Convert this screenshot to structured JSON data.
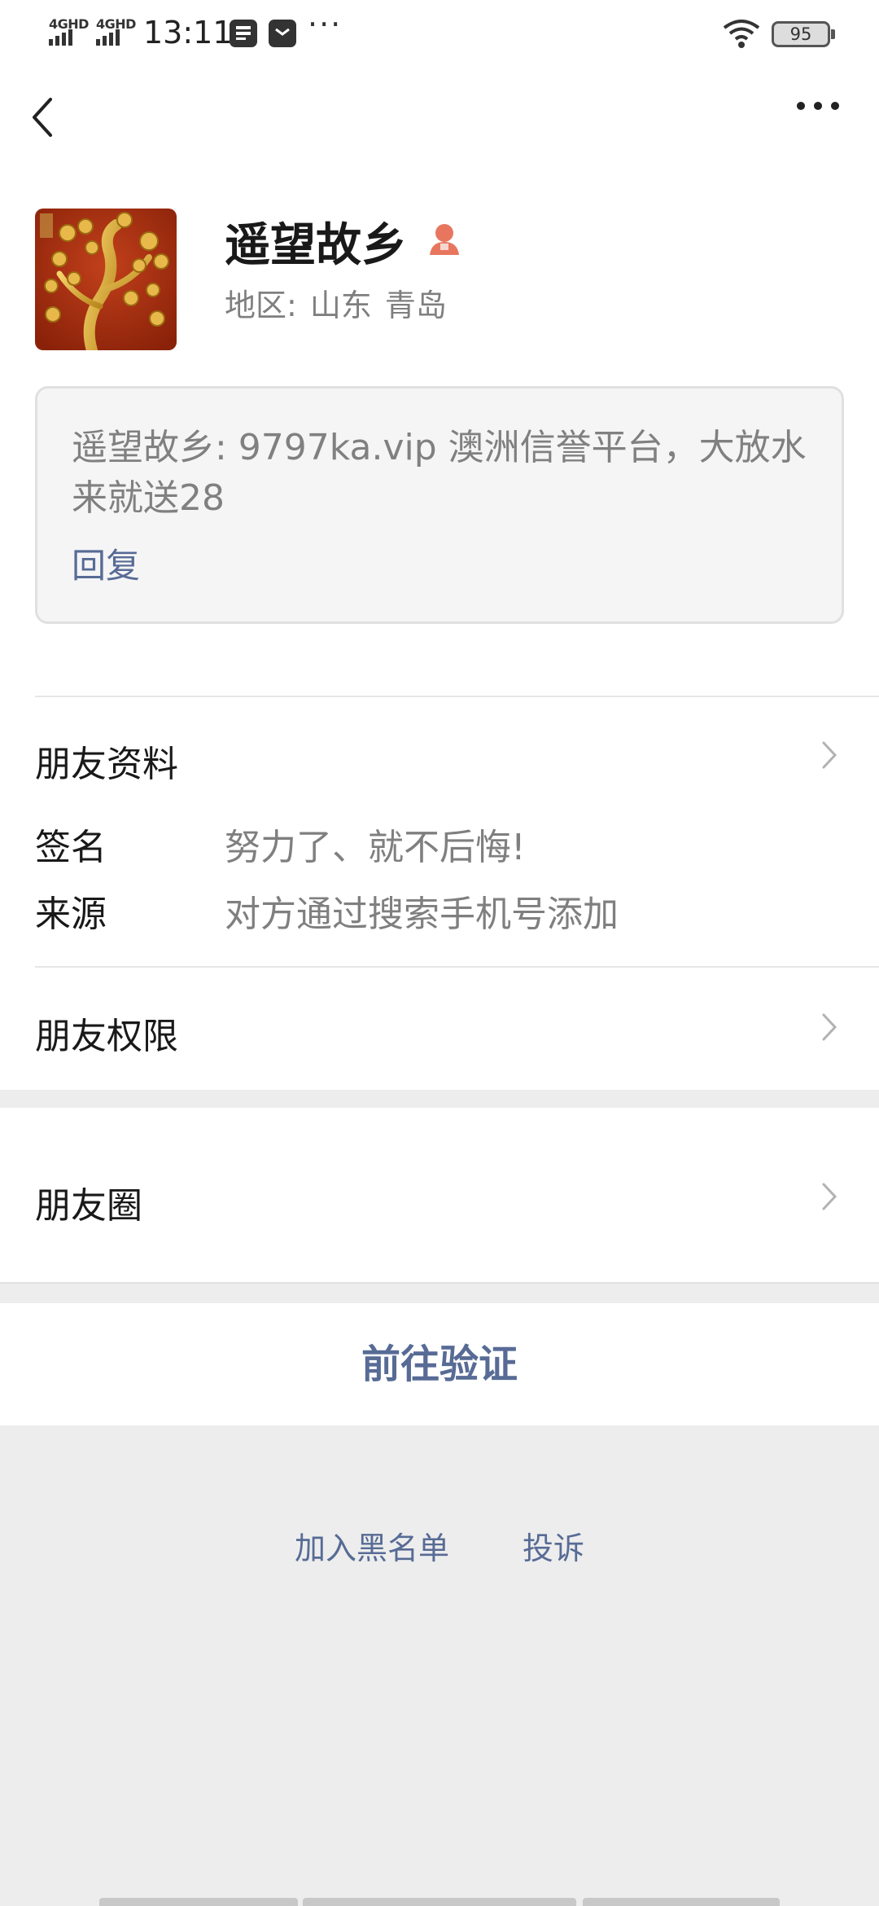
{
  "status_bar": {
    "signal_1": "4GHD",
    "signal_2": "4GHD",
    "time": "13:11",
    "battery": "95",
    "icons": [
      "sim-card-icon",
      "message-icon",
      "more-dots-icon",
      "wifi-icon",
      "battery-icon"
    ]
  },
  "nav": {
    "back_icon": "chevron-left-icon",
    "more_icon": "more-horizontal-icon"
  },
  "profile": {
    "nickname": "遥望故乡",
    "gender_icon": "female-person-icon",
    "region_label": "地区:",
    "region_province": "山东",
    "region_city": "青岛"
  },
  "verification": {
    "message": "遥望故乡: 9797ka.vip 澳洲信誉平台，大放水来就送28",
    "reply_label": "回复"
  },
  "info": {
    "friend_profile_label": "朋友资料",
    "signature_label": "签名",
    "signature_value": "努力了、就不后悔!",
    "source_label": "来源",
    "source_value": "对方通过搜索手机号添加",
    "permissions_label": "朋友权限"
  },
  "moments": {
    "label": "朋友圈"
  },
  "actions": {
    "go_verify": "前往验证",
    "blacklist": "加入黑名单",
    "report": "投诉"
  },
  "colors": {
    "link": "#576b95",
    "background": "#ededed",
    "gender_icon": "#e8765f"
  }
}
